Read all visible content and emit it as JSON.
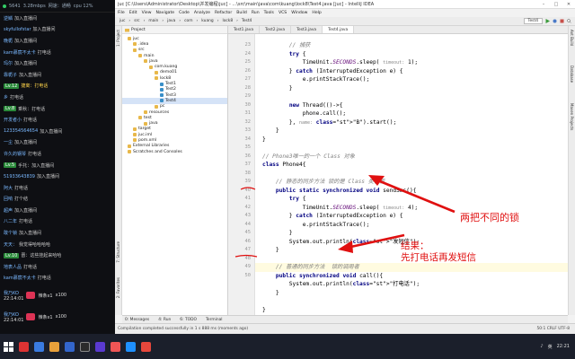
{
  "chat": {
    "top": {
      "viewers": "5641",
      "speed": "3.28mbps",
      "net": "网速：通畅",
      "cpu": "cpu 12%"
    },
    "messages": [
      {
        "user": "逆鳞 ",
        "text": "加入直播间"
      },
      {
        "user": "skyfullofstar ",
        "text": "加入直播间"
      },
      {
        "user": "晚栀 ",
        "text": "加入直播间"
      },
      {
        "user": "kam慕宸不太卡 ",
        "text": "打电话"
      },
      {
        "user": "玛尔 ",
        "text": "加入直播间"
      },
      {
        "user": "靠栀子 ",
        "text": "加入直播间"
      },
      {
        "user": "",
        "badge": "Lv.12",
        "text": "捷离：打电话",
        "hl": true
      },
      {
        "user": "乡 ",
        "text": "打电话"
      },
      {
        "user": "",
        "badge": "Lv.8",
        "text": "乘秋：打电话"
      },
      {
        "user": "开发者小 ",
        "text": "打电话"
      },
      {
        "user": "123354564654 ",
        "text": "加入直播间"
      },
      {
        "user": "一尘 ",
        "text": "加入直播间"
      },
      {
        "user": "许久的钢琴 ",
        "text": "打电话"
      },
      {
        "user": "",
        "badge": "Lv.5",
        "text": "手托：加入直播间"
      },
      {
        "user": "51933643839 ",
        "text": "加入直播间"
      },
      {
        "user": "阿大 ",
        "text": "打电话"
      },
      {
        "user": "回响 ",
        "text": "打个结"
      },
      {
        "user": "超声 ",
        "text": "加入直播间"
      },
      {
        "user": "八二年 ",
        "text": "打电话"
      },
      {
        "user": "敢个锁 ",
        "text": "加入直播间"
      },
      {
        "user": "天天：",
        "text": "我觉得哈哈哈哈"
      },
      {
        "user": "",
        "badge": "Lv.10",
        "text": "晋：这些挂起来哈哈"
      },
      {
        "user": "地表人品 ",
        "text": "打电话"
      },
      {
        "user": "kam慕宸不太卡 ",
        "text": "打电话"
      }
    ],
    "gifts": [
      {
        "user": "我乃KO",
        "time": "22:14:01",
        "gift": "辣条x1",
        "count": "x100"
      },
      {
        "user": "我乃KO",
        "time": "22:14:01",
        "gift": "辣条x1",
        "count": "x100"
      }
    ]
  },
  "ide": {
    "title": "juc [C:\\Users\\Administrator\\Desktop\\并发编程\\juc] - ...\\src\\main\\java\\com\\kuang\\lock8\\Test4.java [juc] - IntelliJ IDEA",
    "menu": [
      "File",
      "Edit",
      "View",
      "Navigate",
      "Code",
      "Analyze",
      "Refactor",
      "Build",
      "Run",
      "Tools",
      "VCS",
      "Window",
      "Help"
    ],
    "breadcrumbs": [
      "juc",
      "src",
      "main",
      "java",
      "com",
      "kuang",
      "lock8",
      "Test4"
    ],
    "run_config": "Test4",
    "project_label": "Project",
    "tree": [
      {
        "label": "juc",
        "indent": 1
      },
      {
        "label": ".idea",
        "indent": 2
      },
      {
        "label": "src",
        "indent": 2
      },
      {
        "label": "main",
        "indent": 3
      },
      {
        "label": "java",
        "indent": 4
      },
      {
        "label": "com.kuang",
        "indent": 5
      },
      {
        "label": "demo01",
        "indent": 6
      },
      {
        "label": "lock8",
        "indent": 6
      },
      {
        "label": "Test1",
        "indent": 7
      },
      {
        "label": "Test2",
        "indent": 7
      },
      {
        "label": "Test3",
        "indent": 7
      },
      {
        "label": "Test4",
        "indent": 7,
        "selected": true
      },
      {
        "label": "pc",
        "indent": 6
      },
      {
        "label": "resources",
        "indent": 4
      },
      {
        "label": "test",
        "indent": 3
      },
      {
        "label": "java",
        "indent": 4
      },
      {
        "label": "target",
        "indent": 2
      },
      {
        "label": "juc.iml",
        "indent": 2
      },
      {
        "label": "pom.xml",
        "indent": 2
      },
      {
        "label": "External Libraries",
        "indent": 1
      },
      {
        "label": "Scratches and Consoles",
        "indent": 1
      }
    ],
    "tabs": [
      "Test1.java",
      "Test2.java",
      "Test3.java",
      "Test4.java"
    ],
    "active_tab": "Test4.java",
    "line_numbers": [
      "23",
      "24",
      "25",
      "26",
      "27",
      "28",
      "29",
      "30",
      "31",
      "32",
      "33",
      "34",
      "35",
      "36",
      "37",
      "38",
      "39",
      "40",
      "41",
      "42",
      "43",
      "44",
      "45",
      "46",
      "47",
      "48",
      "49",
      "50"
    ],
    "code": [
      "        // 捕获",
      "        try {",
      "            TimeUnit.SECONDS.sleep( timeout: 1);",
      "        } catch (InterruptedException e) {",
      "            e.printStackTrace();",
      "        }",
      "",
      "        new Thread(()->{",
      "            phone.call();",
      "        }, name: \"B\").start();",
      "    }",
      "}",
      "",
      "// Phone3唯一的一个 Class 对象",
      "class Phone4{",
      "",
      "    // 静态的同步方法 锁的是 Class 类模板",
      "    public static synchronized void sendSms(){",
      "        try {",
      "            TimeUnit.SECONDS.sleep( timeout: 4);",
      "        } catch (InterruptedException e) {",
      "            e.printStackTrace();",
      "        }",
      "        System.out.println(\"发短信\");",
      "    }",
      "",
      "    // 普通的同步方法  锁的调用者",
      "    public synchronized void call(){",
      "        System.out.println(\"打电话\");",
      "    }",
      "",
      "}"
    ],
    "left_tabs": [
      "1: Project",
      "7: Structure",
      "2: Favorites"
    ],
    "right_tabs": [
      "Ant Build",
      "Database",
      "Maven Projects"
    ],
    "bottom_tabs": [
      "0: Messages",
      "4: Run",
      "6: TODO",
      "Terminal"
    ],
    "status_text": "Compilation completed successfully in 1 s 888 ms (moments ago)",
    "status_right": "50:1  CRLF  UTF-8"
  },
  "annotations": {
    "note1": "两把不同的锁",
    "note2_line1": "结果：",
    "note2_line2": "先打电话再发短信",
    "color": "#e01010"
  },
  "taskbar": {
    "time": "22:21",
    "lang": "英"
  }
}
